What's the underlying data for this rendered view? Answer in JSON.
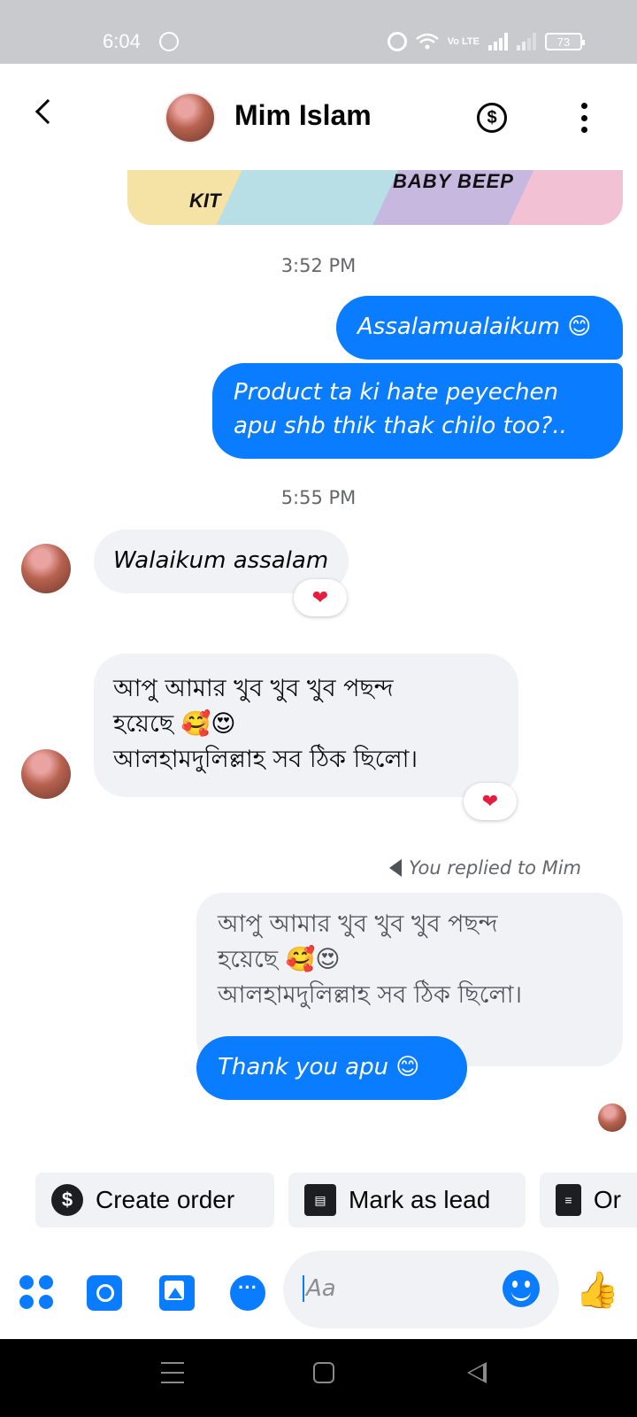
{
  "status_bar": {
    "time": "6:04",
    "network": "Vo LTE",
    "battery": "73"
  },
  "header": {
    "contact_name": "Mim Islam",
    "payment_icon": "dollar-circle-icon",
    "more_icon": "vertical-dots-icon"
  },
  "shared_card": {
    "left_text": "KIT",
    "right_text": "BABY BEEP"
  },
  "messages": {
    "time_1": "3:52 PM",
    "out_1": "Assalamualaikum 😊",
    "out_2_line1": "Product ta ki hate peyechen",
    "out_2_line2": "apu shb thik thak chilo too?..",
    "time_2": "5:55 PM",
    "in_1": "Walaikum assalam",
    "in_1_reaction": "❤",
    "in_2_line1": "আপু আমার খুব খুব খুব পছন্দ",
    "in_2_line2": "হয়েছে 🥰😍",
    "in_2_line3": "আলহামদুলিল্লাহ সব ঠিক ছিলো।",
    "in_2_reaction": "❤",
    "replied_label": "You replied to Mim",
    "quoted_line1": "আপু আমার খুব খুব খুব পছন্দ",
    "quoted_line2": "হয়েছে 🥰😍",
    "quoted_line3": "আলহামদুলিল্লাহ সব ঠিক ছিলো।",
    "out_3": "Thank you apu 😊"
  },
  "quick_actions": {
    "create_order": "Create order",
    "create_order_icon": "$",
    "mark_as_lead": "Mark as lead",
    "orders_partial": "Or"
  },
  "composer": {
    "placeholder": "Aa",
    "like_icon": "👍"
  },
  "colors": {
    "accent": "#0a7cff",
    "incoming_bubble": "#f0f2f5",
    "status_bar": "#c8cacd"
  }
}
